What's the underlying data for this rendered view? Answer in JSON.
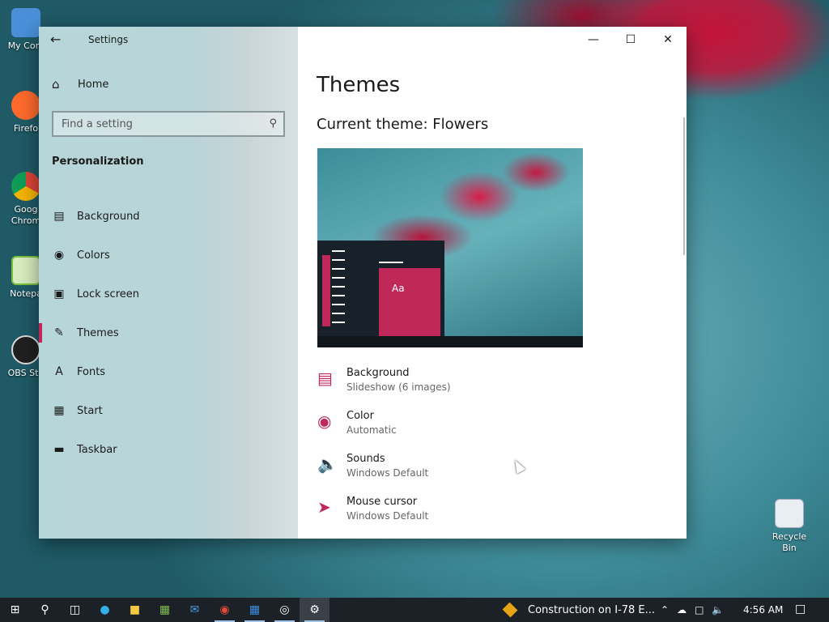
{
  "desktop": {
    "icons": [
      {
        "label": "My Com",
        "icon": "computer-icon",
        "color": "#4a90d9"
      },
      {
        "label": "Firefo",
        "icon": "firefox-icon",
        "color": "#ff6a2b"
      },
      {
        "label": "Goog",
        "label2": "Chrom",
        "icon": "chrome-icon",
        "color": "#1a73e8"
      },
      {
        "label": "Notepa",
        "icon": "notepad-icon",
        "color": "#7bbf3a"
      },
      {
        "label": "OBS Stu",
        "icon": "obs-icon",
        "color": "#202020"
      }
    ],
    "recycle_bin": "Recycle Bin"
  },
  "window": {
    "title": "Settings",
    "home": "Home",
    "search_placeholder": "Find a setting",
    "section": "Personalization",
    "nav": [
      {
        "label": "Background",
        "icon": "picture-icon"
      },
      {
        "label": "Colors",
        "icon": "palette-icon"
      },
      {
        "label": "Lock screen",
        "icon": "lock-screen-icon"
      },
      {
        "label": "Themes",
        "icon": "themes-icon",
        "active": true
      },
      {
        "label": "Fonts",
        "icon": "fonts-icon"
      },
      {
        "label": "Start",
        "icon": "start-icon"
      },
      {
        "label": "Taskbar",
        "icon": "taskbar-icon"
      }
    ]
  },
  "content": {
    "page_title": "Themes",
    "current_theme": "Current theme: Flowers",
    "preview_text": "Aa",
    "accent_color": "#c0285a",
    "properties": [
      {
        "name": "Background",
        "value": "Slideshow (6 images)",
        "icon": "picture-icon"
      },
      {
        "name": "Color",
        "value": "Automatic",
        "icon": "palette-icon"
      },
      {
        "name": "Sounds",
        "value": "Windows Default",
        "icon": "speaker-icon"
      },
      {
        "name": "Mouse cursor",
        "value": "Windows Default",
        "icon": "cursor-icon"
      }
    ]
  },
  "taskbar": {
    "news": "Construction on I-78 E...",
    "time": "4:56 AM"
  }
}
